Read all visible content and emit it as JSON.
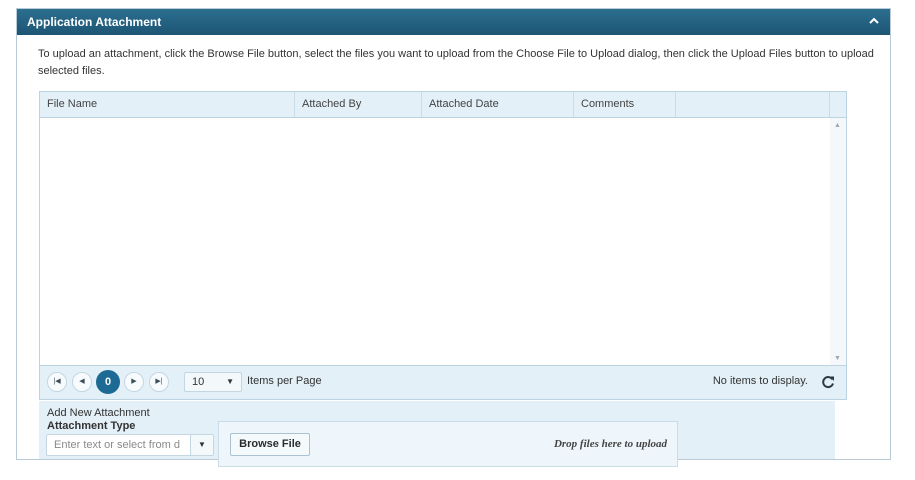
{
  "panel": {
    "title": "Application Attachment",
    "collapse_icon": "chevron-up-icon"
  },
  "instructions": "To upload an attachment, click the Browse File button, select the files you want to upload from the Choose File to Upload dialog, then click the Upload Files button to upload selected files.",
  "grid": {
    "columns": [
      "File Name",
      "Attached By",
      "Attached Date",
      "Comments",
      ""
    ],
    "rows": []
  },
  "pager": {
    "current_page": "0",
    "page_size": "10",
    "items_per_page_label": "Items per Page",
    "status": "No items to display.",
    "icons": [
      "first-page-icon",
      "prev-page-icon",
      "next-page-icon",
      "last-page-icon",
      "refresh-icon"
    ]
  },
  "upload": {
    "add_label": "Add New Attachment",
    "type_label": "Attachment Type",
    "type_placeholder": "Enter text or select from d",
    "browse_label": "Browse File",
    "drop_hint": "Drop files here to upload"
  },
  "colors": {
    "header_bg": "#1d5574",
    "accent": "#1d6a95",
    "grid_header_bg": "#e3f0f8"
  }
}
